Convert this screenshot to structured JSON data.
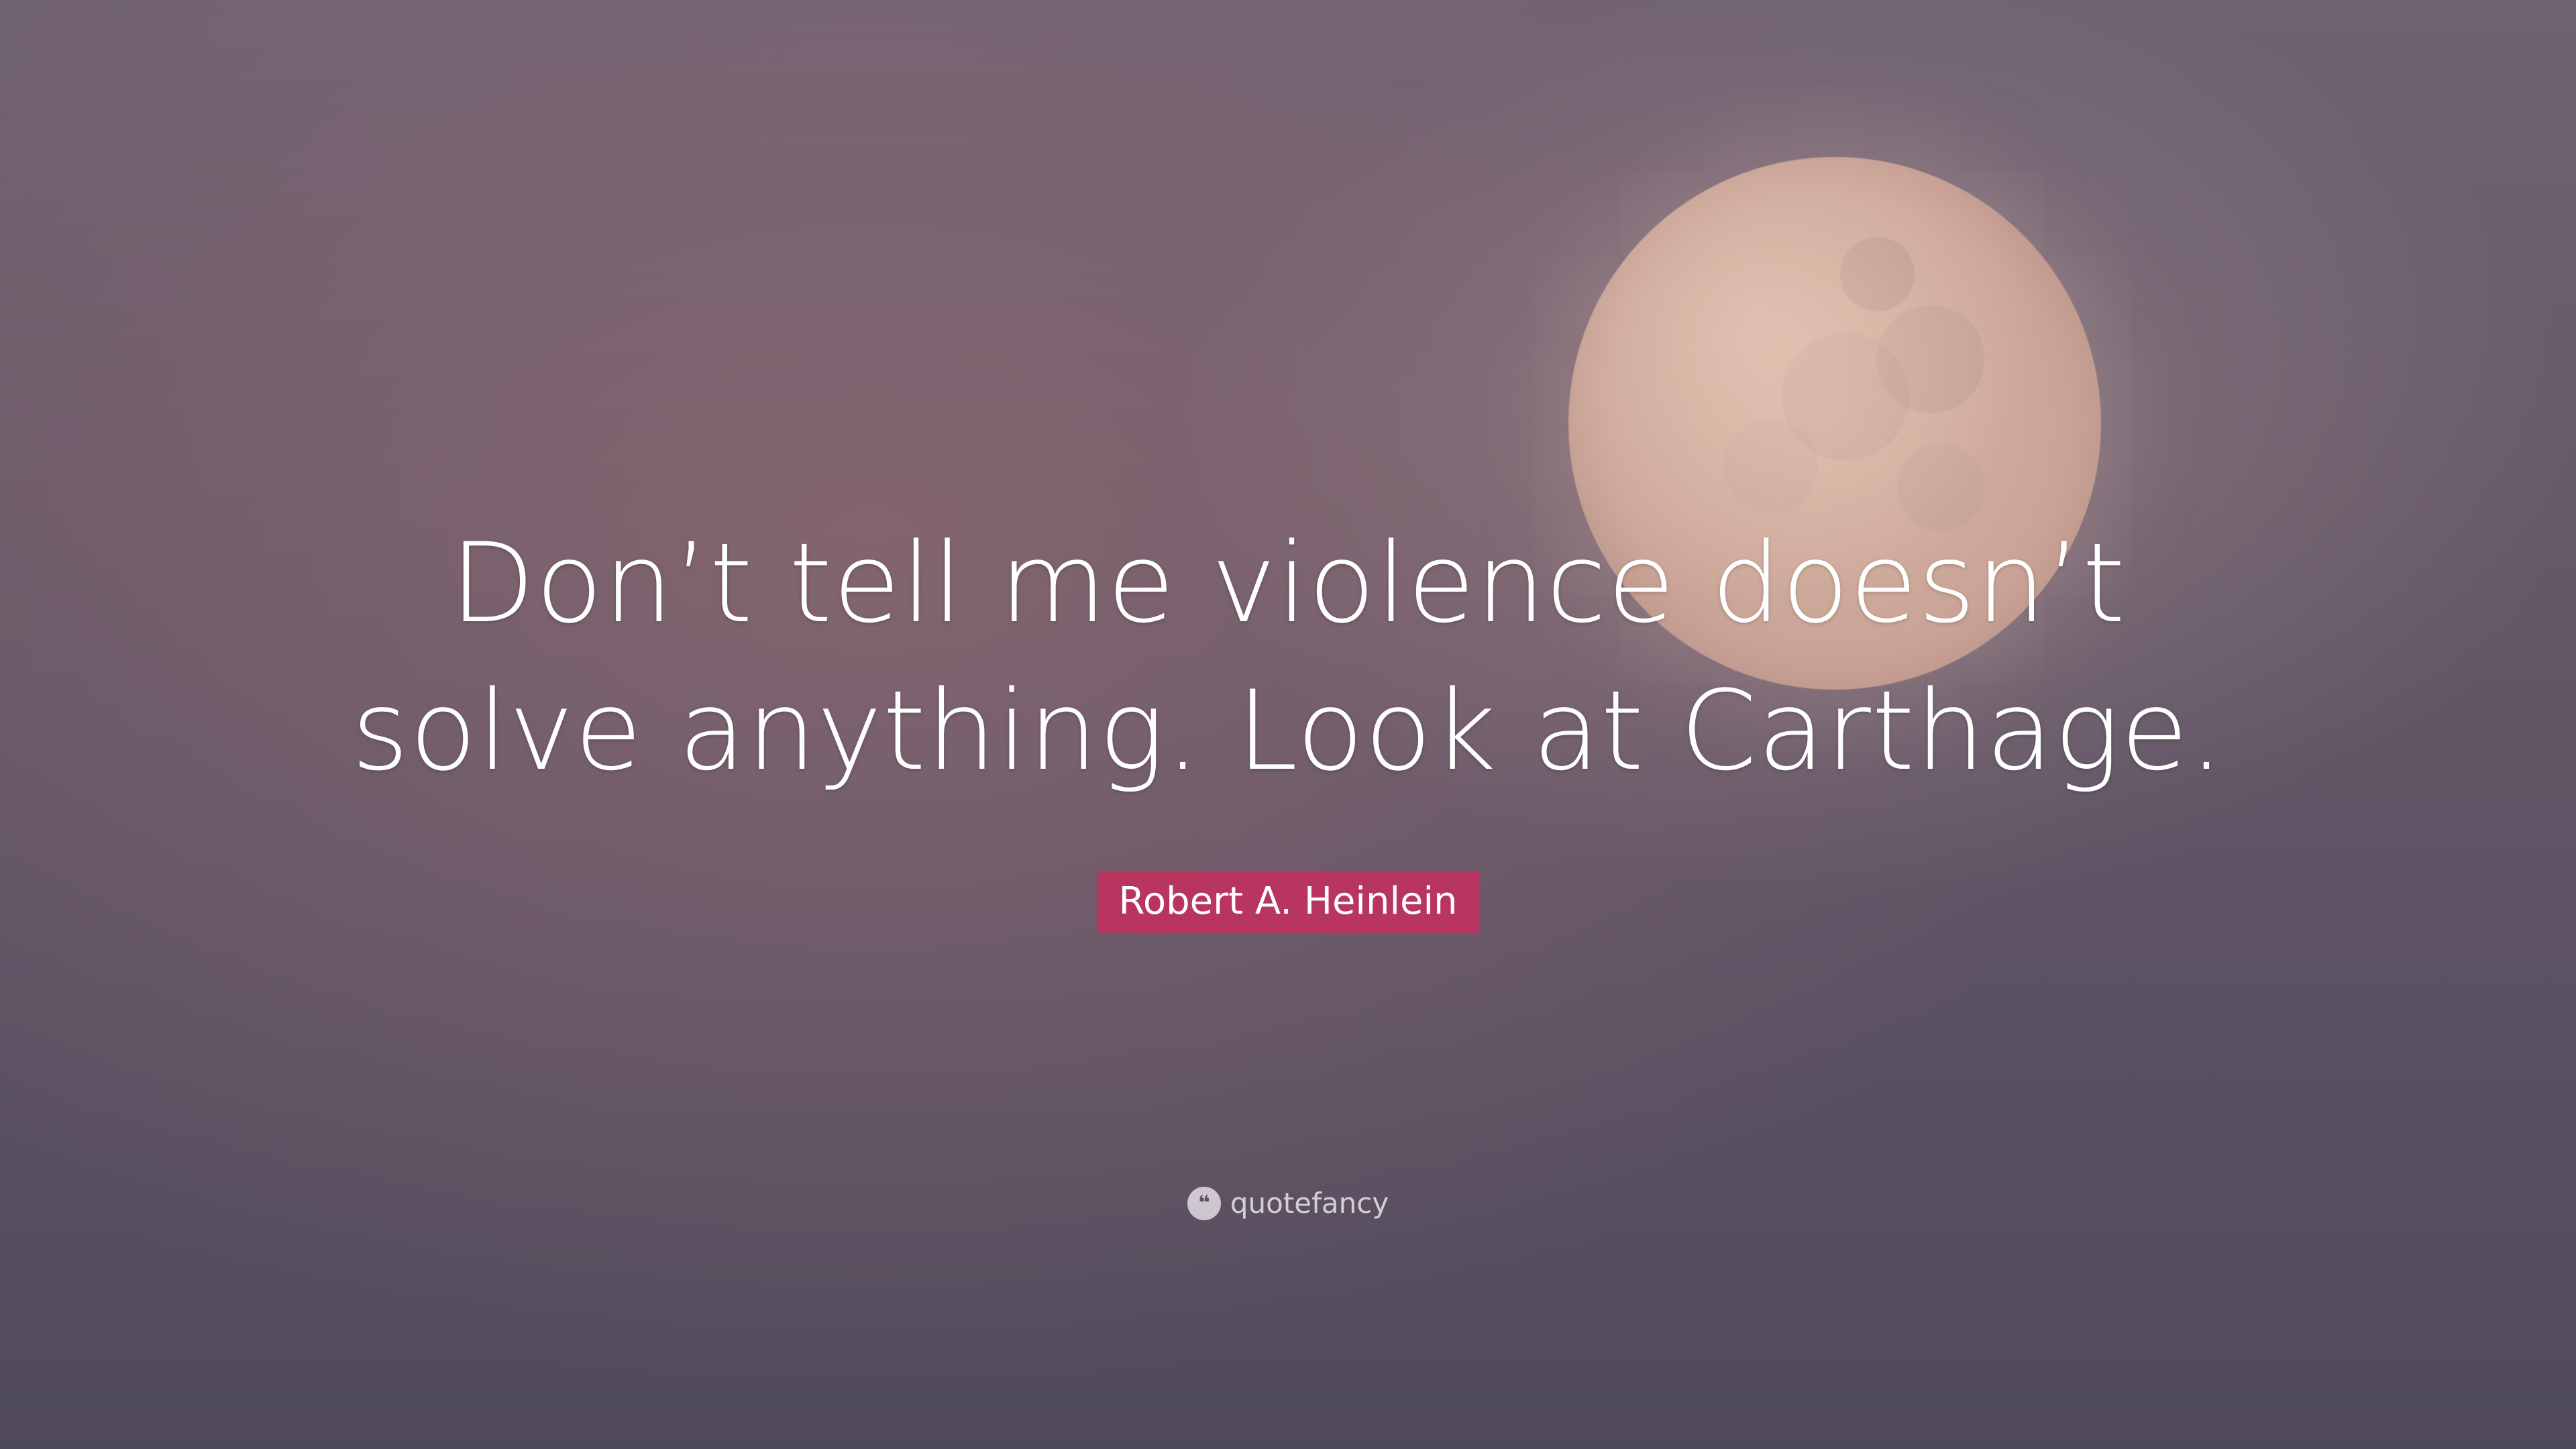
{
  "quote": {
    "lines": [
      "Don’t tell me violence doesn’t",
      "solve anything. Look at Carthage."
    ]
  },
  "author": {
    "name": "Robert A. Heinlein"
  },
  "brand": {
    "icon": "quote-mark-icon",
    "name": "quotefancy"
  },
  "colors": {
    "author_badge": "#b7355f",
    "text": "#ffffff"
  }
}
